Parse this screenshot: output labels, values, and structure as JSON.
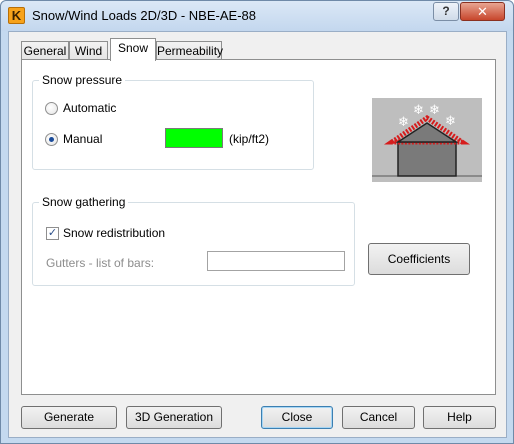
{
  "window": {
    "title": "Snow/Wind Loads 2D/3D - NBE-AE-88",
    "app_icon_letter": "K",
    "help_label": "?",
    "close_label": "✕"
  },
  "tabs": [
    {
      "label": "General",
      "active": false
    },
    {
      "label": "Wind",
      "active": false
    },
    {
      "label": "Snow",
      "active": true
    },
    {
      "label": "Permeability",
      "active": false
    }
  ],
  "snow_pressure": {
    "group_title": "Snow pressure",
    "automatic_label": "Automatic",
    "manual_label": "Manual",
    "selected": "manual",
    "value_color": "#00ff00",
    "unit": "(kip/ft2)"
  },
  "snow_gathering": {
    "group_title": "Snow gathering",
    "redistribution_label": "Snow redistribution",
    "redistribution_checked": true,
    "gutters_label": "Gutters - list of bars:",
    "gutters_value": ""
  },
  "coefficients_button": "Coefficients",
  "bottom_buttons": {
    "generate": "Generate",
    "generation_3d": "3D Generation",
    "close": "Close",
    "cancel": "Cancel",
    "help": "Help"
  },
  "illustration": {
    "background": "#bebebe",
    "snowflake_glyph": "❄",
    "roof_hatch_color": "#d61c1c"
  }
}
